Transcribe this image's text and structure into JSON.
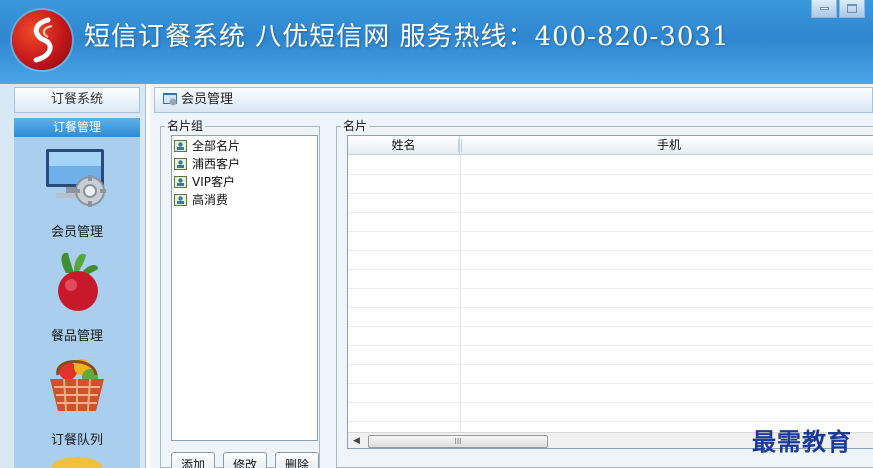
{
  "app": {
    "title": "短信订餐系统  八优短信网  服务热线：400-820-3031",
    "watermark": "最需教育"
  },
  "sidebar": {
    "header": "订餐系统",
    "section": "订餐管理",
    "items": [
      {
        "label": "会员管理",
        "icon": "member-management-icon"
      },
      {
        "label": "餐品管理",
        "icon": "radish-icon"
      },
      {
        "label": "订餐队列",
        "icon": "food-basket-icon"
      }
    ]
  },
  "main": {
    "header": "会员管理",
    "group_box": {
      "legend": "名片组",
      "items": [
        "全部名片",
        "浦西客户",
        "VIP客户",
        "高消费"
      ],
      "buttons": {
        "add": "添加",
        "edit": "修改",
        "delete": "删除"
      }
    },
    "card_box": {
      "legend": "名片",
      "columns": [
        "姓名",
        "手机"
      ],
      "rows": [],
      "scroll_grip": "III"
    }
  },
  "colors": {
    "titlebar": "#2f86d0",
    "sidebar_section": "#2f8bd3",
    "watermark": "#1b3a9c"
  }
}
